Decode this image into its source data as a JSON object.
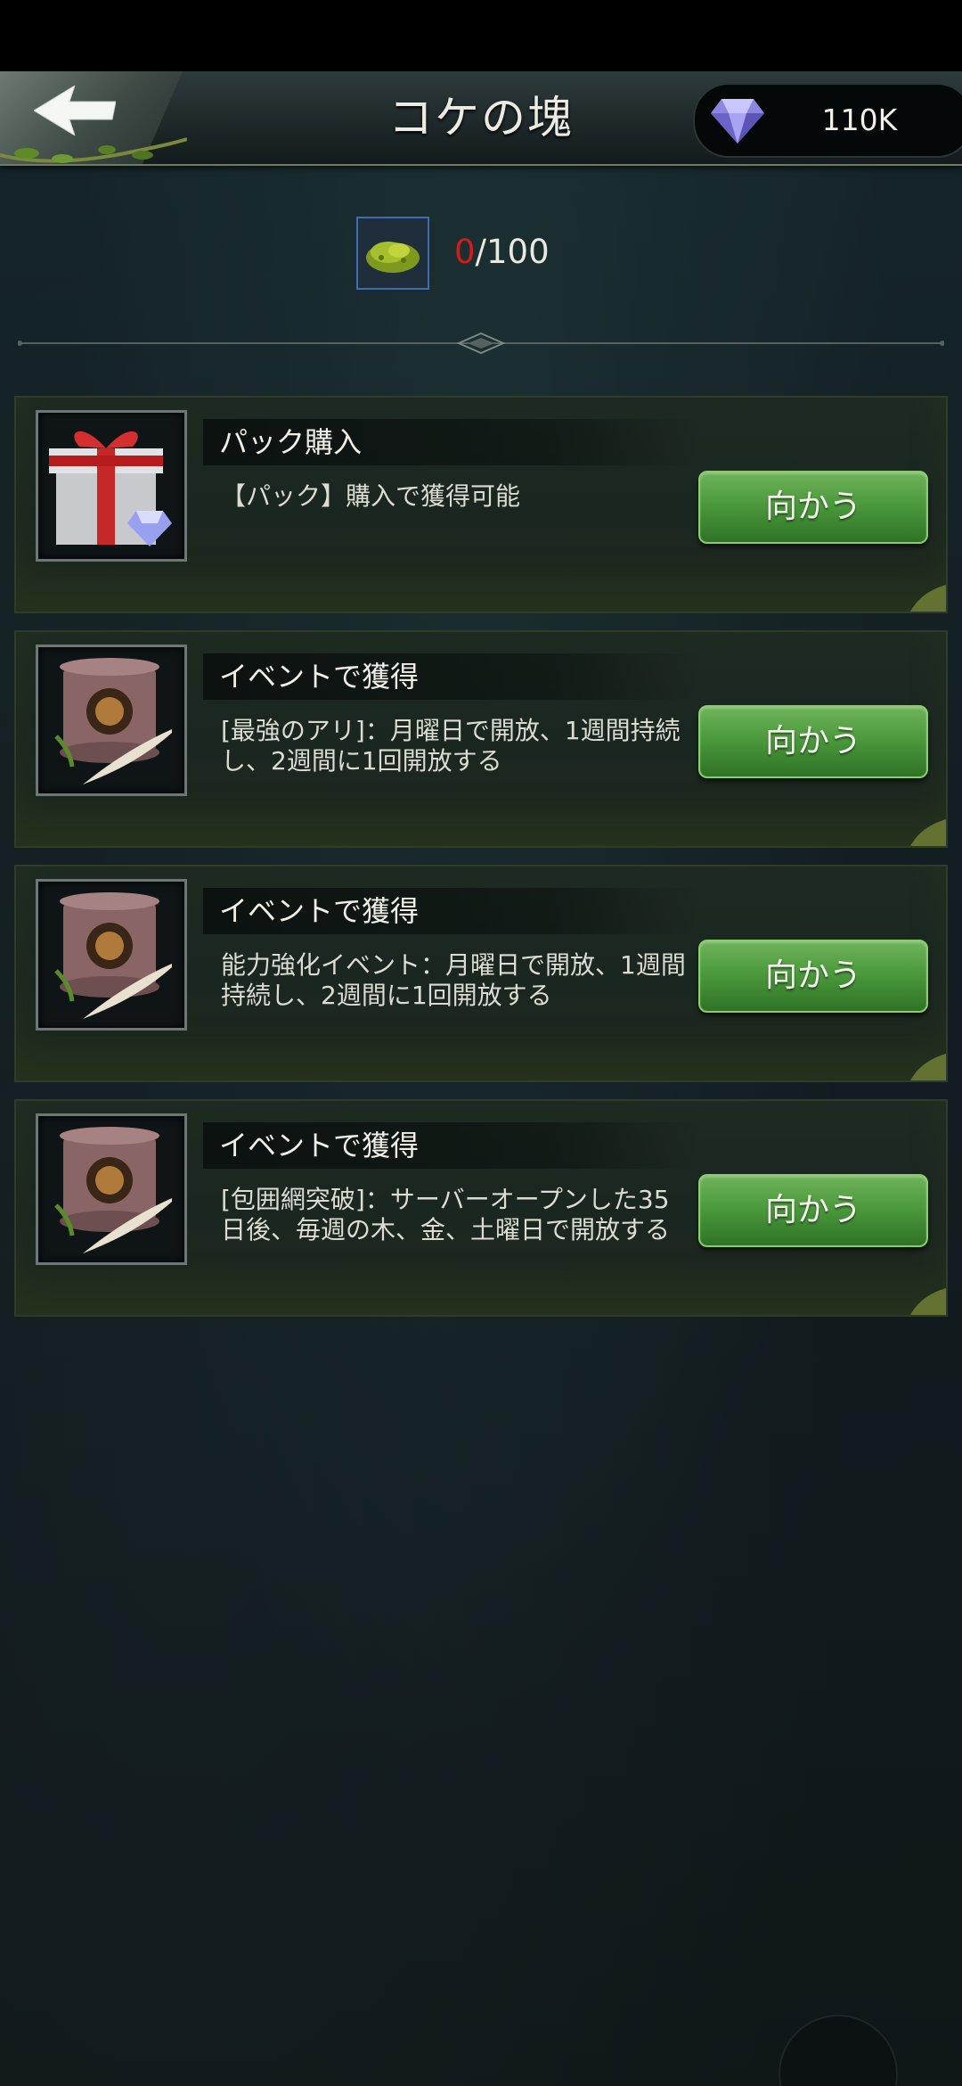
{
  "header": {
    "title": "コケの塊",
    "back_icon": "back-arrow-icon",
    "gems": {
      "icon": "diamond-icon",
      "value": "110K"
    }
  },
  "item": {
    "icon": "moss-icon",
    "current": "0",
    "separator_total": "/100"
  },
  "cards": [
    {
      "icon": "gift-box-icon",
      "title": "パック購入",
      "description": "【パック】購入で獲得可能",
      "button": "向かう"
    },
    {
      "icon": "event-scroll-icon",
      "title": "イベントで獲得",
      "description": "[最強のアリ]：月曜日で開放、1週間持続し、2週間に1回開放する",
      "button": "向かう"
    },
    {
      "icon": "event-scroll-icon",
      "title": "イベントで獲得",
      "description": "能力強化イベント：月曜日で開放、1週間持続し、2週間に1回開放する",
      "button": "向かう"
    },
    {
      "icon": "event-scroll-icon",
      "title": "イベントで獲得",
      "description": "[包囲網突破]：サーバーオープンした35日後、毎週の木、金、土曜日で開放する",
      "button": "向かう"
    }
  ],
  "colors": {
    "accent_green": "#4c9a3d",
    "count_red": "#d41b1b",
    "background": "#121b1e"
  }
}
